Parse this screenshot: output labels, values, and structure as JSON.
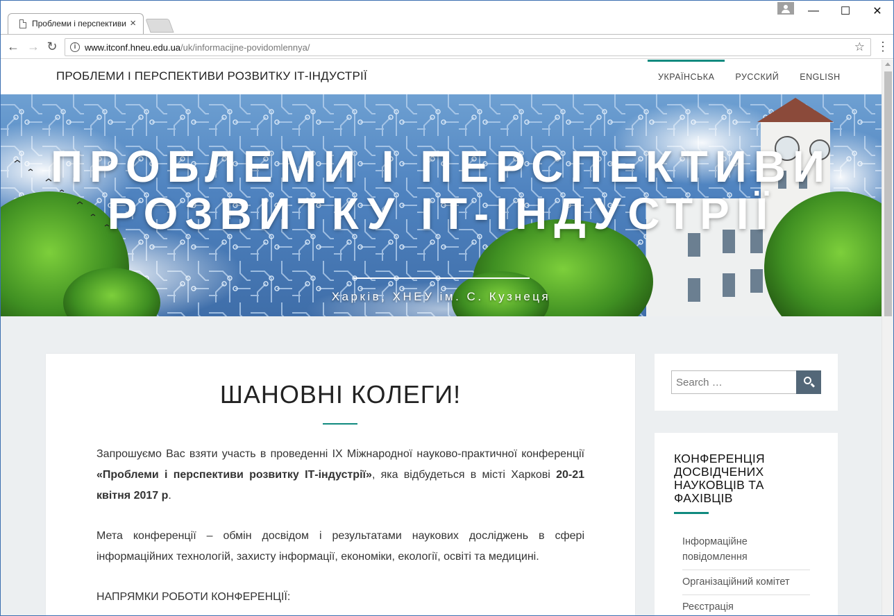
{
  "browser": {
    "tab_title": "Проблеми і перспективи",
    "tab_close": "×",
    "window_controls": {
      "minimize": "—",
      "maximize": "☐",
      "close": "✕"
    },
    "url_host": "www.itconf.hneu.edu.ua",
    "url_path": "/uk/informacijne-povidomlennya/",
    "info_glyph": "i",
    "star_glyph": "☆",
    "menu_glyph": "⋮",
    "back_glyph": "←",
    "forward_glyph": "→",
    "reload_glyph": "↻"
  },
  "site": {
    "title": "ПРОБЛЕМИ І ПЕРСПЕКТИВИ РОЗВИТКУ ІТ-ІНДУСТРІЇ",
    "languages": [
      {
        "label": "УКРАЇНСЬКА",
        "active": true
      },
      {
        "label": "РУССКИЙ",
        "active": false
      },
      {
        "label": "ENGLISH",
        "active": false
      }
    ]
  },
  "hero": {
    "title_line1": "ПРОБЛЕМИ І ПЕРСПЕКТИВИ",
    "title_line2": "РОЗВИТКУ ІТ-ІНДУСТРІЇ",
    "subtitle": "Харків, ХНЕУ ім. С. Кузнеця"
  },
  "post": {
    "heading": "ШАНОВНІ КОЛЕГИ!",
    "p1_a": "Запрошуємо Вас взяти участь в проведенні IX Міжнародної науково-практичної конференції ",
    "p1_b": "«Проблеми і перспективи розвитку ІТ-індустрії»",
    "p1_c": ", яка відбудеться в місті Харкові ",
    "p1_d": "20-21 квітня 2017 р",
    "p1_e": ".",
    "p2": "Мета конференції – обмін досвідом і результатами наукових досліджень в сфері інформаційних технологій, захисту інформації, економіки, екології, освіті та медицині.",
    "p3": "НАПРЯМКИ РОБОТИ КОНФЕРЕНЦІЇ:"
  },
  "sidebar": {
    "search_placeholder": "Search …",
    "widget_title": "КОНФЕРЕНЦІЯ ДОСВІДЧЕНИХ НАУКОВЦІВ ТА ФАХІВЦІВ",
    "links": [
      "Інформаційне повідомлення",
      "Організаційний комітет",
      "Реєстрація"
    ]
  },
  "colors": {
    "accent": "#108a7f",
    "search_button": "#536778",
    "page_background": "#eceff1"
  }
}
